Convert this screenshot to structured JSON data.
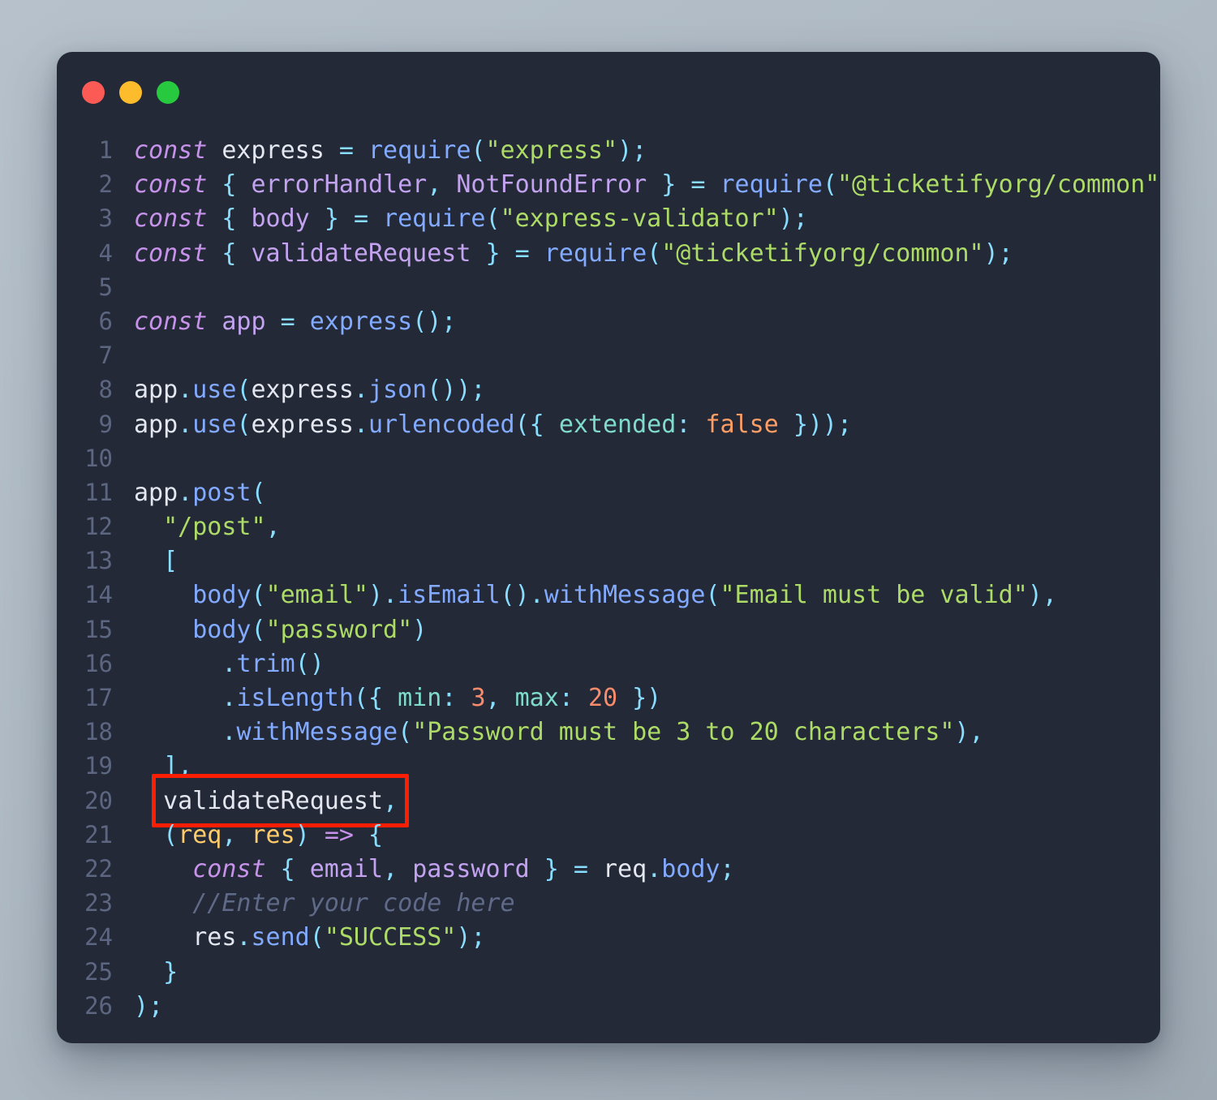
{
  "window": {
    "traffic_lights": [
      {
        "name": "close-button",
        "color": "#fc5b55"
      },
      {
        "name": "minimize-button",
        "color": "#fcbc2c"
      },
      {
        "name": "maximize-button",
        "color": "#27c93f"
      }
    ]
  },
  "annotation": {
    "color": "#fc1e03",
    "target_line": 20,
    "target_text": "validateRequest,"
  },
  "editor": {
    "background": "#242938",
    "language": "javascript",
    "first_line": 1,
    "last_line": 26,
    "line_numbers": [
      "1",
      "2",
      "3",
      "4",
      "5",
      "6",
      "7",
      "8",
      "9",
      "10",
      "11",
      "12",
      "13",
      "14",
      "15",
      "16",
      "17",
      "18",
      "19",
      "20",
      "21",
      "22",
      "23",
      "24",
      "25",
      "26"
    ],
    "lines": [
      {
        "n": "1",
        "text": "const express = require(\"express\");"
      },
      {
        "n": "2",
        "text": "const { errorHandler, NotFoundError } = require(\"@ticketifyorg/common\");"
      },
      {
        "n": "3",
        "text": "const { body } = require(\"express-validator\");"
      },
      {
        "n": "4",
        "text": "const { validateRequest } = require(\"@ticketifyorg/common\");"
      },
      {
        "n": "5",
        "text": ""
      },
      {
        "n": "6",
        "text": "const app = express();"
      },
      {
        "n": "7",
        "text": ""
      },
      {
        "n": "8",
        "text": "app.use(express.json());"
      },
      {
        "n": "9",
        "text": "app.use(express.urlencoded({ extended: false }));"
      },
      {
        "n": "10",
        "text": ""
      },
      {
        "n": "11",
        "text": "app.post("
      },
      {
        "n": "12",
        "text": "  \"/post\","
      },
      {
        "n": "13",
        "text": "  ["
      },
      {
        "n": "14",
        "text": "    body(\"email\").isEmail().withMessage(\"Email must be valid\"),"
      },
      {
        "n": "15",
        "text": "    body(\"password\")"
      },
      {
        "n": "16",
        "text": "      .trim()"
      },
      {
        "n": "17",
        "text": "      .isLength({ min: 3, max: 20 })"
      },
      {
        "n": "18",
        "text": "      .withMessage(\"Password must be 3 to 20 characters\"),"
      },
      {
        "n": "19",
        "text": "  ],"
      },
      {
        "n": "20",
        "text": "  validateRequest,"
      },
      {
        "n": "21",
        "text": "  (req, res) => {"
      },
      {
        "n": "22",
        "text": "    const { email, password } = req.body;"
      },
      {
        "n": "23",
        "text": "    //Enter your code here"
      },
      {
        "n": "24",
        "text": "    res.send(\"SUCCESS\");"
      },
      {
        "n": "25",
        "text": "  }"
      },
      {
        "n": "26",
        "text": ");"
      }
    ],
    "tokens": {
      "keyword_const": "const",
      "fn_require": "require",
      "module_express": "\"express\"",
      "module_common": "\"@ticketifyorg/common\"",
      "module_validator": "\"express-validator\"",
      "ident_express": "express",
      "ident_errorHandler": "errorHandler",
      "ident_NotFoundError": "NotFoundError",
      "ident_body": "body",
      "ident_validateRequest": "validateRequest",
      "ident_app": "app",
      "route_path": "\"/post\"",
      "field_email": "\"email\"",
      "field_password": "\"password\"",
      "msg_email": "\"Email must be valid\"",
      "msg_password": "\"Password must be 3 to 20 characters\"",
      "min_value": "3",
      "max_value": "20",
      "bool_false": "false",
      "key_extended": "extended",
      "key_min": "min",
      "key_max": "max",
      "param_req": "req",
      "param_res": "res",
      "comment_placeholder": "//Enter your code here",
      "response_success": "\"SUCCESS\""
    },
    "colors": {
      "background": "#242938",
      "default_text": "#e4e7f0",
      "line_number": "#5d6680",
      "keyword": "#c792ea",
      "identifier": "#c3a3f0",
      "punctuation": "#89ddff",
      "function": "#82aaff",
      "string": "#addb67",
      "number": "#f78c6c",
      "boolean": "#ff9e64",
      "object_key": "#7fdbca",
      "parameter": "#ffcb6b",
      "comment": "#5f6a89"
    }
  }
}
